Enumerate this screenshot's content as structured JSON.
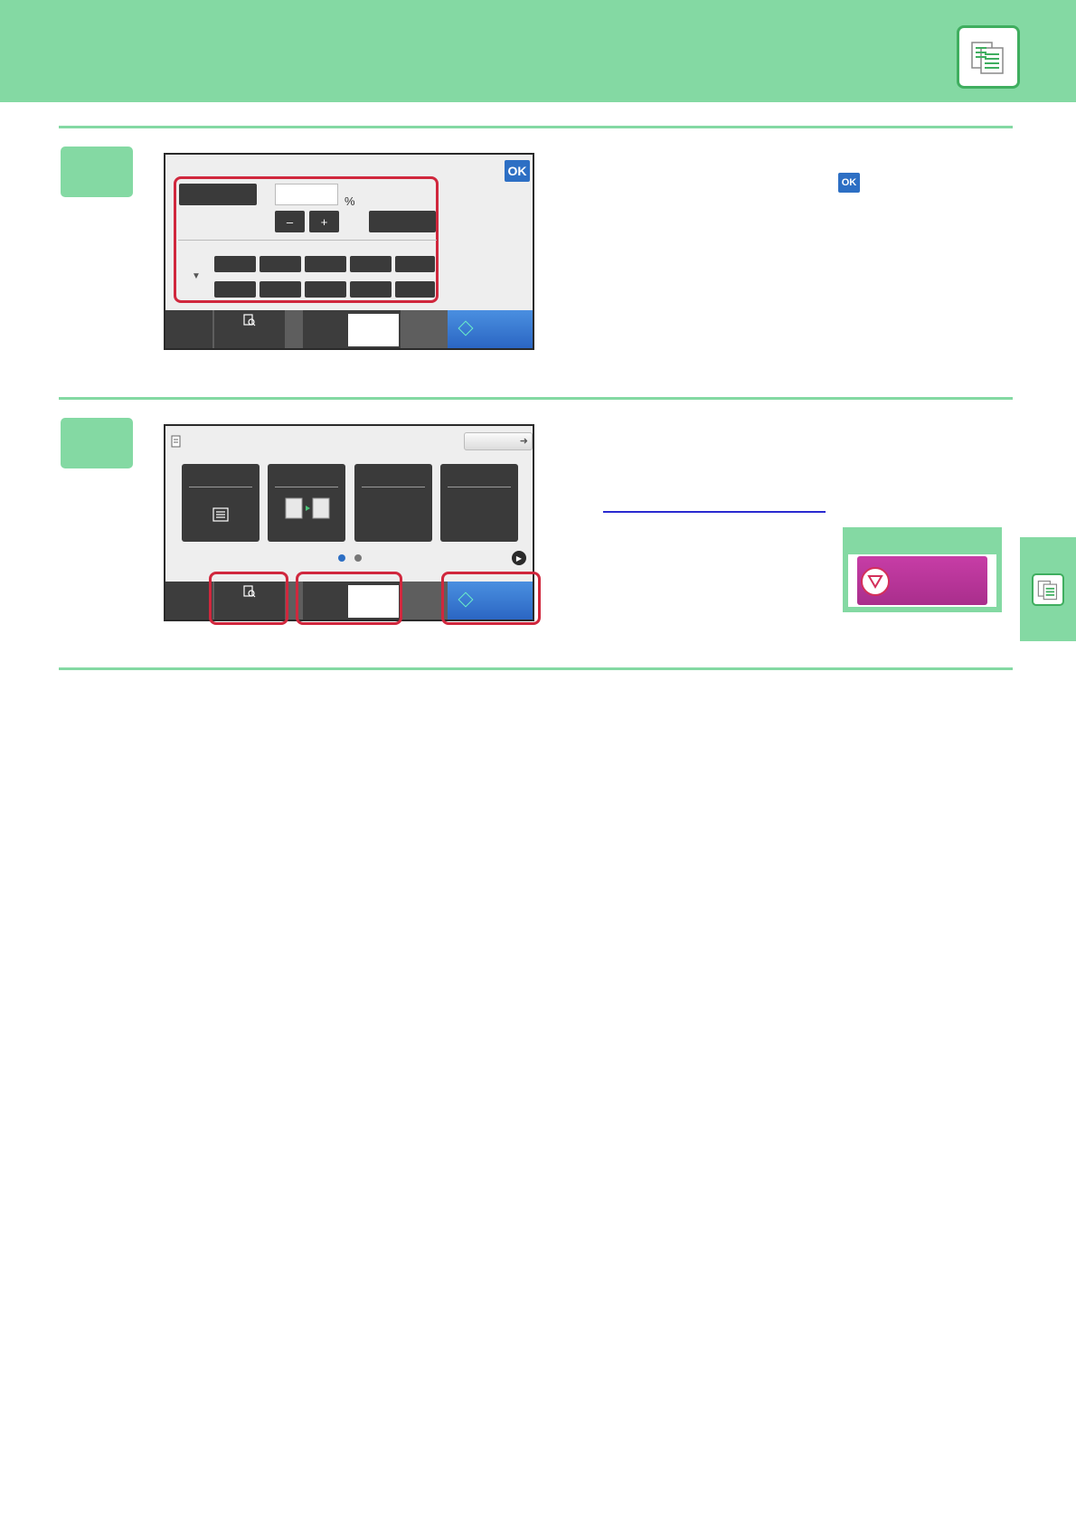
{
  "screen1": {
    "ok_label": "OK",
    "percent_sign": "%",
    "minus_label": "–",
    "plus_label": "+"
  },
  "inline_ok_label": "OK",
  "colors": {
    "header_green": "#84d9a3",
    "highlight_red": "#d0273d",
    "start_blue": "#2b66c3",
    "stop_magenta": "#b7339a"
  }
}
